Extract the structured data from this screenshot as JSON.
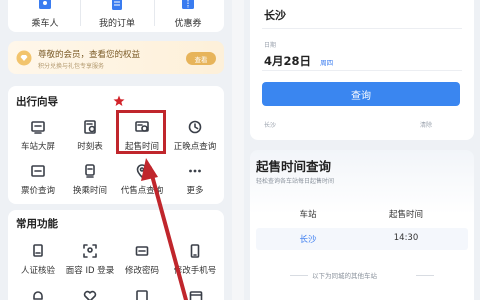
{
  "top_menu": {
    "items": [
      {
        "label": "乘车人"
      },
      {
        "label": "我的订单"
      },
      {
        "label": "优惠券"
      }
    ]
  },
  "member_banner": {
    "title": "尊敬的会员，查看您的权益",
    "subtitle": "积分兑换与礼包专享服务",
    "button": "查看"
  },
  "travel_guide": {
    "title": "出行向导",
    "items": [
      {
        "label": "车站大屏",
        "icon": "screen-icon"
      },
      {
        "label": "时刻表",
        "icon": "timetable-icon"
      },
      {
        "label": "起售时间",
        "icon": "ticket-clock-icon"
      },
      {
        "label": "正晚点查询",
        "icon": "clock-icon"
      },
      {
        "label": "票价查询",
        "icon": "price-icon"
      },
      {
        "label": "换乘时间",
        "icon": "transfer-icon"
      },
      {
        "label": "代售点查询",
        "icon": "location-icon"
      },
      {
        "label": "更多",
        "icon": "more-icon"
      }
    ]
  },
  "common_functions": {
    "title": "常用功能",
    "items": [
      {
        "label": "人证核验",
        "icon": "id-check-icon"
      },
      {
        "label": "面容 ID 登录",
        "icon": "face-id-icon"
      },
      {
        "label": "修改密码",
        "icon": "password-icon"
      },
      {
        "label": "修改手机号",
        "icon": "phone-icon"
      }
    ]
  },
  "query_panel": {
    "station": "长沙",
    "date_label": "日期",
    "date": "4月28日",
    "weekday": "周四",
    "button": "查询",
    "history_station": "长沙",
    "clear": "清除"
  },
  "sale_time": {
    "title": "起售时间查询",
    "subtitle": "轻松查询各车站每日起售时间",
    "col_station": "车站",
    "col_time": "起售时间",
    "rows": [
      {
        "station": "长沙",
        "time": "14:30"
      }
    ],
    "footer": "以下为同城的其他车站"
  },
  "colors": {
    "accent": "#3a7cf0",
    "highlight_box": "#c0262c",
    "star": "#d2232a"
  }
}
